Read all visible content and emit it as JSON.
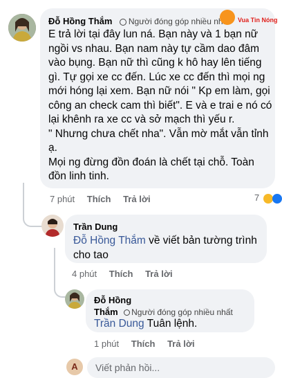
{
  "comment1": {
    "author": "Đỗ Hồng Thắm",
    "badge": "Người đóng góp nhiều nhất",
    "text": "E trả lời tại đây lun ná. Bạn này và 1 bạn nữ\nngồi vs nhau. Bạn nam này tự cầm dao đâm\nvào bụng. Bạn nữ thì cũng k hô hay lên tiếng\ngì. Tự gọi xe cc đến. Lúc xe cc đến thì mọi ng\nmới hóng lại xem. Bạn nữ nói \" Kp em làm, gọi\ncông an check cam thì biết\". E và e trai e nó có\nlại khênh ra xe cc và sở mạch thì yếu r.\n\" Nhưng chưa chết nha\". Vẫn mờ mắt vẫn tỉnh\nạ.\nMọi ng đừng đồn đoán là chết tại chỗ. Toàn\nđồn linh tinh.",
    "time": "7 phút",
    "like": "Thích",
    "reply": "Trả lời",
    "reaction_count": "7"
  },
  "watermark": "Vua Tin Nóng",
  "comment2": {
    "author": "Trần Dung",
    "mention": "Đỗ Hồng Thắm",
    "text": " về viết bản tường trình\ncho tao",
    "time": "4 phút",
    "like": "Thích",
    "reply": "Trả lời"
  },
  "comment3": {
    "author_line1": "Đỗ Hồng",
    "author_line2": "Thắm",
    "badge": "Người đóng góp nhiều nhất",
    "mention": "Trần Dung",
    "text": " Tuân lệnh.",
    "time": "1 phút",
    "like": "Thích",
    "reply": "Trả lời"
  },
  "reply_box": {
    "placeholder": "Viết phản hồi...",
    "avatar_letter": "A"
  },
  "colors": {
    "bubble": "#f0f2f5",
    "mention": "#385898",
    "meta": "#65676b",
    "watermark_bg": "#f7941d",
    "watermark_text": "#e0201b",
    "reaction_haha": "#f7b928",
    "reaction_like": "#1877f2"
  }
}
